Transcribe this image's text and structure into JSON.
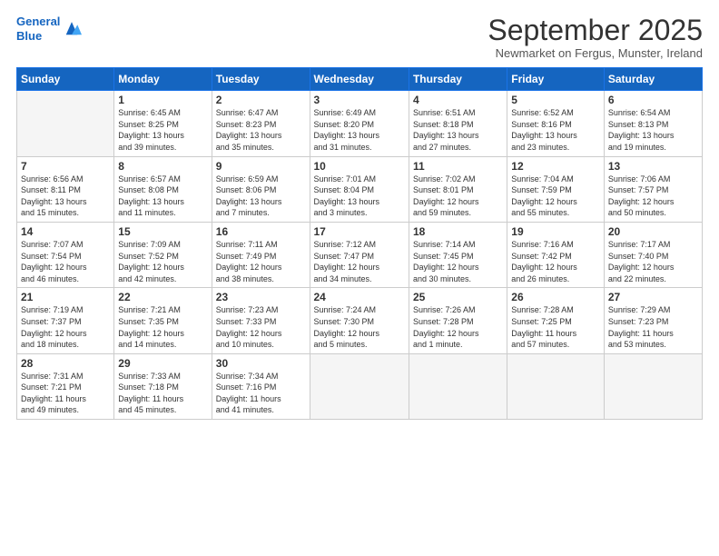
{
  "logo": {
    "line1": "General",
    "line2": "Blue"
  },
  "title": "September 2025",
  "location": "Newmarket on Fergus, Munster, Ireland",
  "days_header": [
    "Sunday",
    "Monday",
    "Tuesday",
    "Wednesday",
    "Thursday",
    "Friday",
    "Saturday"
  ],
  "weeks": [
    [
      {
        "num": "",
        "info": ""
      },
      {
        "num": "1",
        "info": "Sunrise: 6:45 AM\nSunset: 8:25 PM\nDaylight: 13 hours\nand 39 minutes."
      },
      {
        "num": "2",
        "info": "Sunrise: 6:47 AM\nSunset: 8:23 PM\nDaylight: 13 hours\nand 35 minutes."
      },
      {
        "num": "3",
        "info": "Sunrise: 6:49 AM\nSunset: 8:20 PM\nDaylight: 13 hours\nand 31 minutes."
      },
      {
        "num": "4",
        "info": "Sunrise: 6:51 AM\nSunset: 8:18 PM\nDaylight: 13 hours\nand 27 minutes."
      },
      {
        "num": "5",
        "info": "Sunrise: 6:52 AM\nSunset: 8:16 PM\nDaylight: 13 hours\nand 23 minutes."
      },
      {
        "num": "6",
        "info": "Sunrise: 6:54 AM\nSunset: 8:13 PM\nDaylight: 13 hours\nand 19 minutes."
      }
    ],
    [
      {
        "num": "7",
        "info": "Sunrise: 6:56 AM\nSunset: 8:11 PM\nDaylight: 13 hours\nand 15 minutes."
      },
      {
        "num": "8",
        "info": "Sunrise: 6:57 AM\nSunset: 8:08 PM\nDaylight: 13 hours\nand 11 minutes."
      },
      {
        "num": "9",
        "info": "Sunrise: 6:59 AM\nSunset: 8:06 PM\nDaylight: 13 hours\nand 7 minutes."
      },
      {
        "num": "10",
        "info": "Sunrise: 7:01 AM\nSunset: 8:04 PM\nDaylight: 13 hours\nand 3 minutes."
      },
      {
        "num": "11",
        "info": "Sunrise: 7:02 AM\nSunset: 8:01 PM\nDaylight: 12 hours\nand 59 minutes."
      },
      {
        "num": "12",
        "info": "Sunrise: 7:04 AM\nSunset: 7:59 PM\nDaylight: 12 hours\nand 55 minutes."
      },
      {
        "num": "13",
        "info": "Sunrise: 7:06 AM\nSunset: 7:57 PM\nDaylight: 12 hours\nand 50 minutes."
      }
    ],
    [
      {
        "num": "14",
        "info": "Sunrise: 7:07 AM\nSunset: 7:54 PM\nDaylight: 12 hours\nand 46 minutes."
      },
      {
        "num": "15",
        "info": "Sunrise: 7:09 AM\nSunset: 7:52 PM\nDaylight: 12 hours\nand 42 minutes."
      },
      {
        "num": "16",
        "info": "Sunrise: 7:11 AM\nSunset: 7:49 PM\nDaylight: 12 hours\nand 38 minutes."
      },
      {
        "num": "17",
        "info": "Sunrise: 7:12 AM\nSunset: 7:47 PM\nDaylight: 12 hours\nand 34 minutes."
      },
      {
        "num": "18",
        "info": "Sunrise: 7:14 AM\nSunset: 7:45 PM\nDaylight: 12 hours\nand 30 minutes."
      },
      {
        "num": "19",
        "info": "Sunrise: 7:16 AM\nSunset: 7:42 PM\nDaylight: 12 hours\nand 26 minutes."
      },
      {
        "num": "20",
        "info": "Sunrise: 7:17 AM\nSunset: 7:40 PM\nDaylight: 12 hours\nand 22 minutes."
      }
    ],
    [
      {
        "num": "21",
        "info": "Sunrise: 7:19 AM\nSunset: 7:37 PM\nDaylight: 12 hours\nand 18 minutes."
      },
      {
        "num": "22",
        "info": "Sunrise: 7:21 AM\nSunset: 7:35 PM\nDaylight: 12 hours\nand 14 minutes."
      },
      {
        "num": "23",
        "info": "Sunrise: 7:23 AM\nSunset: 7:33 PM\nDaylight: 12 hours\nand 10 minutes."
      },
      {
        "num": "24",
        "info": "Sunrise: 7:24 AM\nSunset: 7:30 PM\nDaylight: 12 hours\nand 5 minutes."
      },
      {
        "num": "25",
        "info": "Sunrise: 7:26 AM\nSunset: 7:28 PM\nDaylight: 12 hours\nand 1 minute."
      },
      {
        "num": "26",
        "info": "Sunrise: 7:28 AM\nSunset: 7:25 PM\nDaylight: 11 hours\nand 57 minutes."
      },
      {
        "num": "27",
        "info": "Sunrise: 7:29 AM\nSunset: 7:23 PM\nDaylight: 11 hours\nand 53 minutes."
      }
    ],
    [
      {
        "num": "28",
        "info": "Sunrise: 7:31 AM\nSunset: 7:21 PM\nDaylight: 11 hours\nand 49 minutes."
      },
      {
        "num": "29",
        "info": "Sunrise: 7:33 AM\nSunset: 7:18 PM\nDaylight: 11 hours\nand 45 minutes."
      },
      {
        "num": "30",
        "info": "Sunrise: 7:34 AM\nSunset: 7:16 PM\nDaylight: 11 hours\nand 41 minutes."
      },
      {
        "num": "",
        "info": ""
      },
      {
        "num": "",
        "info": ""
      },
      {
        "num": "",
        "info": ""
      },
      {
        "num": "",
        "info": ""
      }
    ]
  ]
}
